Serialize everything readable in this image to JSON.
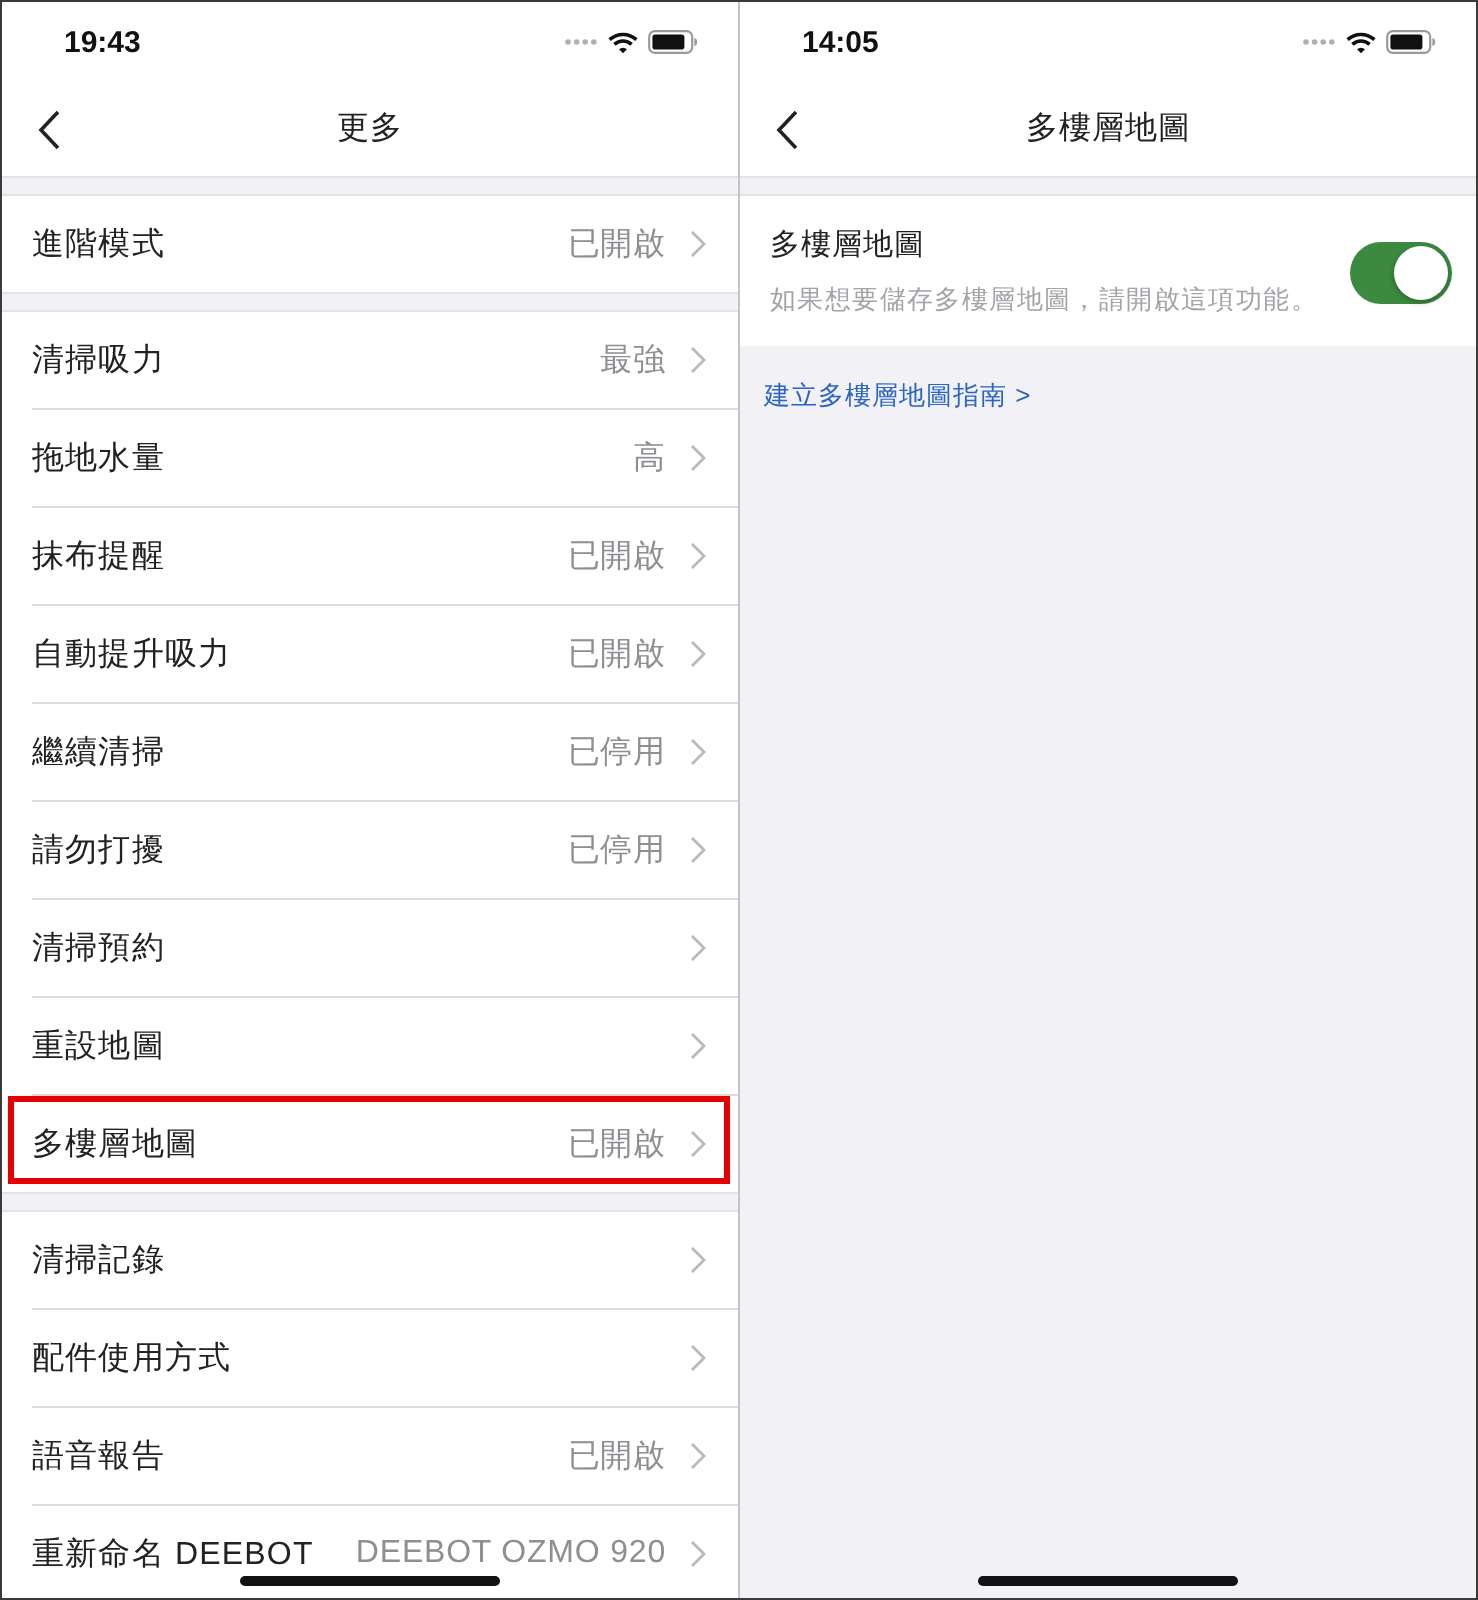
{
  "screens": [
    {
      "kind": "list",
      "status_bar": {
        "time": "19:43"
      },
      "nav_bar": {
        "title": "更多"
      },
      "groups": [
        {
          "rows": [
            {
              "label": "進階模式",
              "value": "已開啟",
              "highlighted": false
            }
          ]
        },
        {
          "rows": [
            {
              "label": "清掃吸力",
              "value": "最強",
              "highlighted": false
            },
            {
              "label": "拖地水量",
              "value": "高",
              "highlighted": false
            },
            {
              "label": "抹布提醒",
              "value": "已開啟",
              "highlighted": false
            },
            {
              "label": "自動提升吸力",
              "value": "已開啟",
              "highlighted": false
            },
            {
              "label": "繼續清掃",
              "value": "已停用",
              "highlighted": false
            },
            {
              "label": "請勿打擾",
              "value": "已停用",
              "highlighted": false
            },
            {
              "label": "清掃預約",
              "highlighted": false
            },
            {
              "label": "重設地圖",
              "highlighted": false
            },
            {
              "label": "多樓層地圖",
              "value": "已開啟",
              "highlighted": true
            }
          ]
        },
        {
          "rows": [
            {
              "label": "清掃記錄",
              "highlighted": false
            },
            {
              "label": "配件使用方式",
              "highlighted": false
            },
            {
              "label": "語音報告",
              "value": "已開啟",
              "highlighted": false
            },
            {
              "label": "重新命名 DEEBOT",
              "value": "DEEBOT OZMO 920",
              "highlighted": false
            }
          ]
        }
      ]
    },
    {
      "kind": "detail",
      "status_bar": {
        "time": "14:05"
      },
      "nav_bar": {
        "title": "多樓層地圖"
      },
      "setting": {
        "title": "多樓層地圖",
        "description": "如果想要儲存多樓層地圖，請開啟這項功能。",
        "on": true
      },
      "link": "建立多樓層地圖指南 >"
    }
  ]
}
